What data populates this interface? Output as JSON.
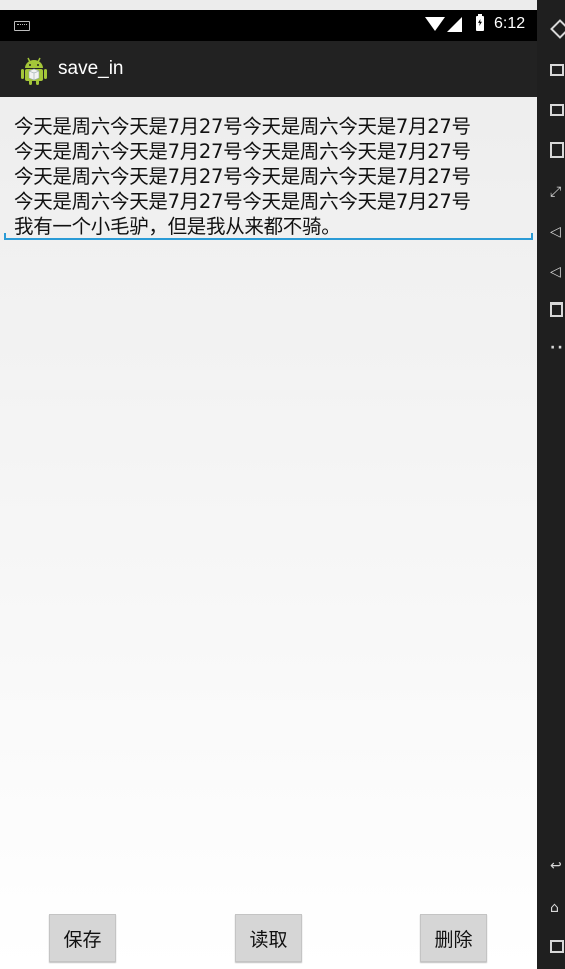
{
  "status_bar": {
    "time": "6:12"
  },
  "action_bar": {
    "title": "save_in"
  },
  "edit_text": {
    "lines": [
      "今天是周六今天是7月27号今天是周六今天是7月27号",
      "今天是周六今天是7月27号今天是周六今天是7月27号",
      "今天是周六今天是7月27号今天是周六今天是7月27号",
      "今天是周六今天是7月27号今天是周六今天是7月27号",
      "我有一个小毛驴，但是我从来都不骑。"
    ]
  },
  "buttons": {
    "save": "保存",
    "read": "读取",
    "delete": "删除"
  },
  "emulator_toolbar": {
    "icons": [
      "rotate-icon",
      "keyboard-icon",
      "screen-icon",
      "apk-install-icon",
      "fullscreen-icon",
      "volume-down-icon",
      "volume-up-icon",
      "trash-icon",
      "more-icon",
      "back-icon",
      "home-icon",
      "recents-icon"
    ]
  }
}
